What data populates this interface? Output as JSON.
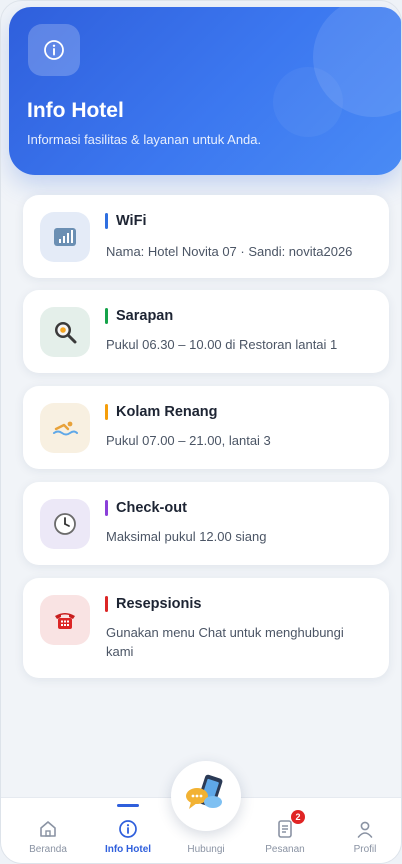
{
  "header": {
    "title": "Info Hotel",
    "subtitle": "Informasi fasilitas & layanan untuk Anda."
  },
  "cards": [
    {
      "title": "WiFi",
      "desc": "Nama: Hotel Novita 07 · Sandi: novita2026",
      "accent": "#2f6fe0",
      "icon_bg": "#e4ebf7",
      "icon": "wifi-signal-icon"
    },
    {
      "title": "Sarapan",
      "desc": "Pukul 06.30 – 10.00 di Restoran lantai 1",
      "accent": "#16a34a",
      "icon_bg": "#e4efea",
      "icon": "breakfast-pan-icon"
    },
    {
      "title": "Kolam Renang",
      "desc": "Pukul 07.00 – 21.00, lantai 3",
      "accent": "#f59e0b",
      "icon_bg": "#f8f0e1",
      "icon": "swimmer-icon"
    },
    {
      "title": "Check-out",
      "desc": "Maksimal pukul 12.00 siang",
      "accent": "#8b3fd9",
      "icon_bg": "#ece8f7",
      "icon": "clock-icon"
    },
    {
      "title": "Resepsionis",
      "desc": "Gunakan menu Chat untuk menghubungi kami",
      "accent": "#dc2626",
      "icon_bg": "#f9e3e3",
      "icon": "telephone-icon"
    }
  ],
  "nav": {
    "items": [
      {
        "label": "Beranda",
        "icon": "home-icon"
      },
      {
        "label": "Info Hotel",
        "icon": "info-icon",
        "active": true
      },
      {
        "label": "Hubungi",
        "icon": "chat-phone-icon"
      },
      {
        "label": "Pesanan",
        "icon": "receipt-icon",
        "badge": "2"
      },
      {
        "label": "Profil",
        "icon": "user-icon"
      }
    ]
  },
  "colors": {
    "primary": "#2f5fdc",
    "badge": "#e02424"
  }
}
